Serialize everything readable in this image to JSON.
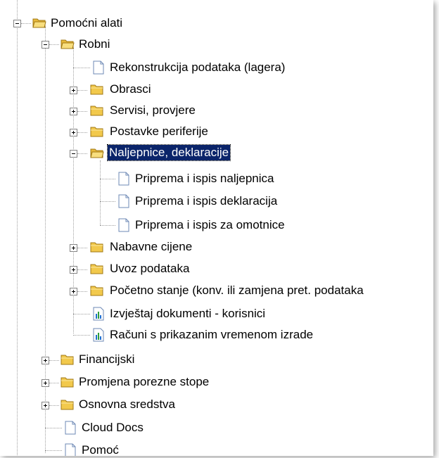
{
  "tree": {
    "root": {
      "label": "Pomoćni alati",
      "icon": "folder-icon",
      "expanded": true
    },
    "robni": {
      "label": "Robni",
      "icon": "folder-icon",
      "expanded": true
    },
    "rekonstrukcija": {
      "label": "Rekonstrukcija podataka (lagera)",
      "icon": "document-icon"
    },
    "obrasci": {
      "label": "Obrasci",
      "icon": "folder-icon",
      "expanded": false
    },
    "servisi": {
      "label": "Servisi, provjere",
      "icon": "folder-icon",
      "expanded": false
    },
    "postavke": {
      "label": "Postavke periferije",
      "icon": "folder-icon",
      "expanded": false
    },
    "naljepnice": {
      "label": "Naljepnice, deklaracije",
      "icon": "folder-icon",
      "expanded": true,
      "selected": true
    },
    "priprema_naljepnica": {
      "label": "Priprema i ispis naljepnica",
      "icon": "document-icon"
    },
    "priprema_deklaracija": {
      "label": "Priprema i ispis deklaracija",
      "icon": "document-icon"
    },
    "priprema_omotnice": {
      "label": "Priprema i ispis za omotnice",
      "icon": "document-icon"
    },
    "nabavne": {
      "label": "Nabavne cijene",
      "icon": "folder-icon",
      "expanded": false
    },
    "uvoz": {
      "label": "Uvoz podataka",
      "icon": "folder-icon",
      "expanded": false
    },
    "pocetno": {
      "label": "Početno stanje (konv. ili zamjena pret. podataka",
      "icon": "folder-icon",
      "expanded": false
    },
    "izvjestaj": {
      "label": "Izvještaj dokumenti - korisnici",
      "icon": "report-icon"
    },
    "racuni": {
      "label": "Računi s prikazanim vremenom izrade",
      "icon": "report-icon"
    },
    "financijski": {
      "label": "Financijski",
      "icon": "folder-icon",
      "expanded": false
    },
    "promjena": {
      "label": "Promjena porezne stope",
      "icon": "folder-icon",
      "expanded": false
    },
    "osnovna": {
      "label": "Osnovna sredstva",
      "icon": "folder-icon",
      "expanded": false
    },
    "cloud": {
      "label": "Cloud Docs",
      "icon": "document-icon"
    },
    "pomoc": {
      "label": "Pomoć",
      "icon": "document-icon"
    }
  },
  "colors": {
    "selection_bg": "#0a246a",
    "folder_yellow": "#f5d35a",
    "report_blue": "#1e6fd0",
    "report_green": "#2e9e3a"
  }
}
